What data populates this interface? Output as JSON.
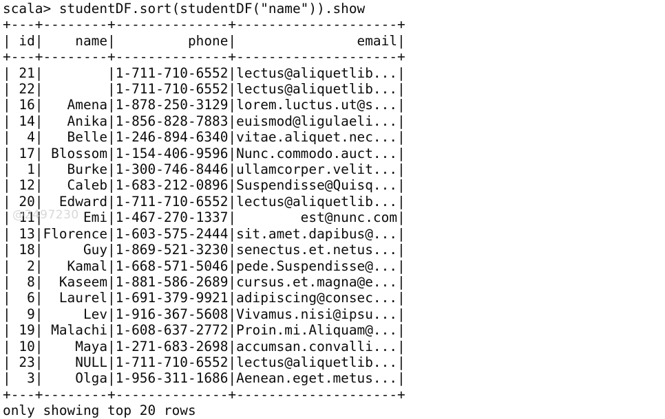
{
  "terminal": {
    "prompt": "scala> ",
    "command": "studentDF.sort(studentDF(\"name\")).show",
    "prompt_line": "scala> studentDF.sort(studentDF(\"name\")).show",
    "separator": "+---+--------+--------------+--------------------+",
    "header_line": "| id|    name|         phone|               email|",
    "footer": "only showing top 20 rows",
    "watermark": "@2497230",
    "background_color": "#ffffff",
    "text_color": "#0b0b0b",
    "watermark_color": "#d8d8d8"
  },
  "table": {
    "columns": [
      {
        "name": "id",
        "width": 3,
        "align": "right"
      },
      {
        "name": "name",
        "width": 8,
        "align": "right"
      },
      {
        "name": "phone",
        "width": 14,
        "align": "right"
      },
      {
        "name": "email",
        "width": 20,
        "align": "right"
      }
    ],
    "rows": [
      {
        "id": "21",
        "name": "",
        "phone": "1-711-710-6552",
        "email": "lectus@aliquetlib..."
      },
      {
        "id": "22",
        "name": "",
        "phone": "1-711-710-6552",
        "email": "lectus@aliquetlib..."
      },
      {
        "id": "16",
        "name": "Amena",
        "phone": "1-878-250-3129",
        "email": "lorem.luctus.ut@s..."
      },
      {
        "id": "14",
        "name": "Anika",
        "phone": "1-856-828-7883",
        "email": "euismod@ligulaeli..."
      },
      {
        "id": "4",
        "name": "Belle",
        "phone": "1-246-894-6340",
        "email": "vitae.aliquet.nec..."
      },
      {
        "id": "17",
        "name": "Blossom",
        "phone": "1-154-406-9596",
        "email": "Nunc.commodo.auct..."
      },
      {
        "id": "1",
        "name": "Burke",
        "phone": "1-300-746-8446",
        "email": "ullamcorper.velit..."
      },
      {
        "id": "12",
        "name": "Caleb",
        "phone": "1-683-212-0896",
        "email": "Suspendisse@Quisq..."
      },
      {
        "id": "20",
        "name": "Edward",
        "phone": "1-711-710-6552",
        "email": "lectus@aliquetlib..."
      },
      {
        "id": "11",
        "name": "Emi",
        "phone": "1-467-270-1337",
        "email": "est@nunc.com"
      },
      {
        "id": "13",
        "name": "Florence",
        "phone": "1-603-575-2444",
        "email": "sit.amet.dapibus@..."
      },
      {
        "id": "18",
        "name": "Guy",
        "phone": "1-869-521-3230",
        "email": "senectus.et.netus..."
      },
      {
        "id": "2",
        "name": "Kamal",
        "phone": "1-668-571-5046",
        "email": "pede.Suspendisse@..."
      },
      {
        "id": "8",
        "name": "Kaseem",
        "phone": "1-881-586-2689",
        "email": "cursus.et.magna@e..."
      },
      {
        "id": "6",
        "name": "Laurel",
        "phone": "1-691-379-9921",
        "email": "adipiscing@consec..."
      },
      {
        "id": "9",
        "name": "Lev",
        "phone": "1-916-367-5608",
        "email": "Vivamus.nisi@ipsu..."
      },
      {
        "id": "19",
        "name": "Malachi",
        "phone": "1-608-637-2772",
        "email": "Proin.mi.Aliquam@..."
      },
      {
        "id": "10",
        "name": "Maya",
        "phone": "1-271-683-2698",
        "email": "accumsan.convalli..."
      },
      {
        "id": "23",
        "name": "NULL",
        "phone": "1-711-710-6552",
        "email": "lectus@aliquetlib..."
      },
      {
        "id": "3",
        "name": "Olga",
        "phone": "1-956-311-1686",
        "email": "Aenean.eget.metus..."
      }
    ]
  }
}
